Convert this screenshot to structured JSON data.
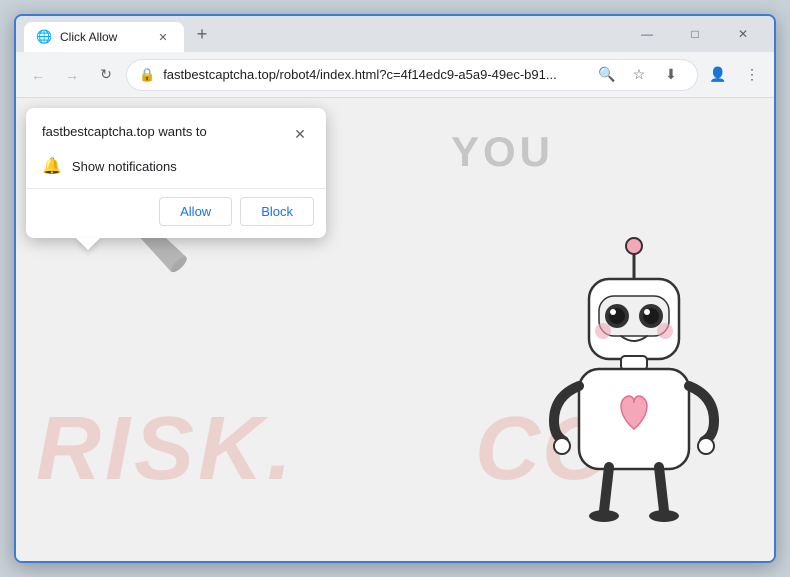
{
  "window": {
    "title": "Click Allow",
    "controls": {
      "minimize": "—",
      "maximize": "□",
      "close": "✕"
    }
  },
  "tab": {
    "title": "Click Allow",
    "favicon": "🌐"
  },
  "addressBar": {
    "url": "fastbestcaptcha.top/robot4/index.html?c=4f14edc9-a5a9-49ec-b91...",
    "lock": "🔒"
  },
  "popup": {
    "title": "fastbestcaptcha.top wants to",
    "notification_text": "Show notifications",
    "allow_label": "Allow",
    "block_label": "Block",
    "close_symbol": "✕"
  },
  "page": {
    "you_text": "YOU",
    "watermark_risk": "RISK.",
    "watermark_com": "CO"
  },
  "icons": {
    "back": "←",
    "forward": "→",
    "refresh": "↻",
    "search": "🔍",
    "star": "☆",
    "account": "👤",
    "menu": "⋮",
    "download": "⬇"
  }
}
